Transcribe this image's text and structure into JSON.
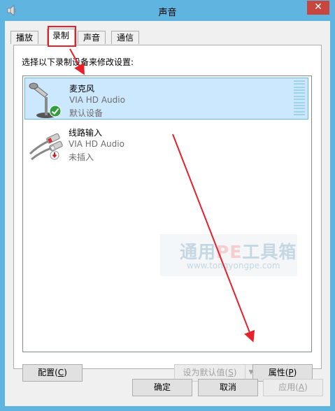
{
  "window": {
    "title": "声音",
    "close_label": "✕"
  },
  "tabs": [
    {
      "label": "播放"
    },
    {
      "label": "录制"
    },
    {
      "label": "声音"
    },
    {
      "label": "通信"
    }
  ],
  "instruction": "选择以下录制设备来修改设置:",
  "devices": [
    {
      "name": "麦克风",
      "driver": "VIA HD Audio",
      "status": "默认设备",
      "icon": "microphone-icon",
      "badge": "check-badge-icon"
    },
    {
      "name": "线路输入",
      "driver": "VIA HD Audio",
      "status": "未插入",
      "icon": "line-in-cable-icon",
      "badge": "unplugged-badge-icon"
    }
  ],
  "watermark": {
    "main_prefix": "通用",
    "main_pe": "PE",
    "main_suffix": "工具箱",
    "url": "www.tongyongpe.com"
  },
  "buttons": {
    "configure": "配置(C)",
    "set_default": "设为默认值(S)",
    "properties": "属性(P)",
    "ok": "确定",
    "cancel": "取消",
    "apply": "应用(A)"
  },
  "colors": {
    "titlebar": "#5fb4e0",
    "close": "#c7463d",
    "selection": "#cce8ff",
    "annotation_red": "#e8202a"
  }
}
